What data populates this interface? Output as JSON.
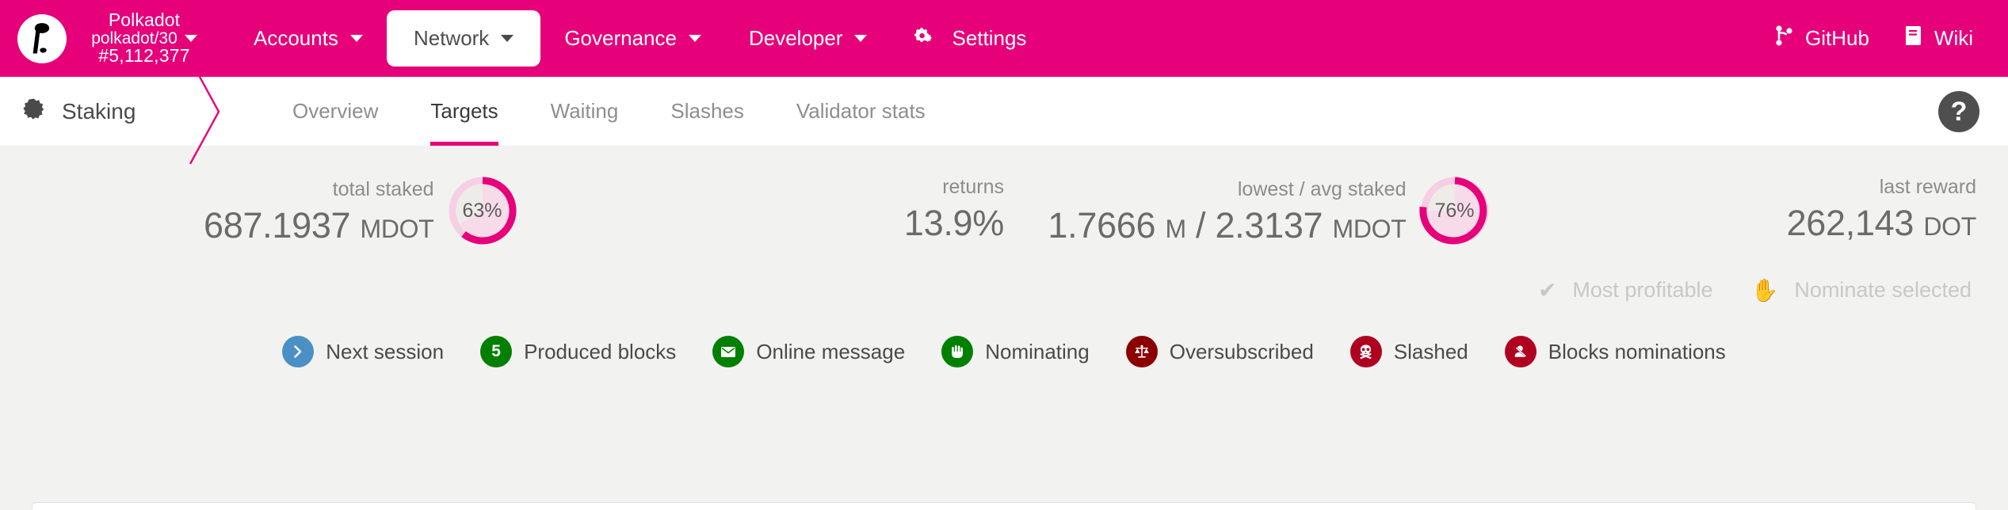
{
  "header": {
    "logo_icon": "polkadot-logo-icon",
    "brand": {
      "name": "Polkadot",
      "chain": "polkadot/30",
      "block": "#5,112,377"
    },
    "nav": [
      {
        "label": "Accounts",
        "has_caret": true,
        "active": false
      },
      {
        "label": "Network",
        "has_caret": true,
        "active": true
      },
      {
        "label": "Governance",
        "has_caret": true,
        "active": false
      },
      {
        "label": "Developer",
        "has_caret": true,
        "active": false
      },
      {
        "label": "Settings",
        "has_caret": false,
        "active": false,
        "icon": "gears-icon"
      }
    ],
    "links": [
      {
        "label": "GitHub",
        "icon": "code-branch-icon"
      },
      {
        "label": "Wiki",
        "icon": "book-icon"
      }
    ],
    "accent_color": "#e6007a"
  },
  "tabbar": {
    "section_title": "Staking",
    "section_icon": "certificate-icon",
    "tabs": [
      {
        "label": "Overview",
        "active": false
      },
      {
        "label": "Targets",
        "active": true
      },
      {
        "label": "Waiting",
        "active": false
      },
      {
        "label": "Slashes",
        "active": false
      },
      {
        "label": "Validator stats",
        "active": false
      }
    ],
    "help_label": "?"
  },
  "summary": {
    "total_staked": {
      "label": "total staked",
      "value": "687.1937",
      "unit": "MDOT",
      "percent": "63%",
      "percent_value": 63
    },
    "returns": {
      "label": "returns",
      "value": "13.9%"
    },
    "lowest_avg_staked": {
      "label": "lowest / avg staked",
      "lowest_value": "1.7666",
      "lowest_unit": "M",
      "separator": "/",
      "avg_value": "2.3137",
      "avg_unit": "MDOT",
      "percent": "76%",
      "percent_value": 76
    },
    "last_reward": {
      "label": "last reward",
      "value": "262,143",
      "unit": "DOT"
    }
  },
  "actions": [
    {
      "label": "Most profitable",
      "icon": "check-icon",
      "glyph": "✔",
      "disabled": true
    },
    {
      "label": "Nominate selected",
      "icon": "hand-paper-icon",
      "glyph": "✋",
      "disabled": true
    }
  ],
  "legend": [
    {
      "label": "Next session",
      "icon": "chevron-right-icon",
      "glyph": "›",
      "color": "#4a90c4",
      "badge_text": ""
    },
    {
      "label": "Produced blocks",
      "icon": "block-count-icon",
      "glyph": "",
      "color": "#008000",
      "badge_text": "5"
    },
    {
      "label": "Online message",
      "icon": "envelope-icon",
      "glyph": "✉",
      "color": "#008000",
      "badge_text": ""
    },
    {
      "label": "Nominating",
      "icon": "hand-paper-icon",
      "glyph": "✋",
      "color": "#008000",
      "badge_text": ""
    },
    {
      "label": "Oversubscribed",
      "icon": "balance-scale-icon",
      "glyph": "⚖",
      "color": "#8b0000",
      "badge_text": ""
    },
    {
      "label": "Slashed",
      "icon": "skull-crossbones-icon",
      "glyph": "☠",
      "color": "#b00020",
      "badge_text": ""
    },
    {
      "label": "Blocks nominations",
      "icon": "user-slash-icon",
      "glyph": "",
      "color": "#b00020",
      "badge_text": ""
    }
  ],
  "colors": {
    "accent": "#e6007a",
    "accent_light": "#f9cfe4",
    "page_bg": "#f2f2f0",
    "panel_bg": "#ffffff",
    "text_muted": "#8c8c8c"
  }
}
